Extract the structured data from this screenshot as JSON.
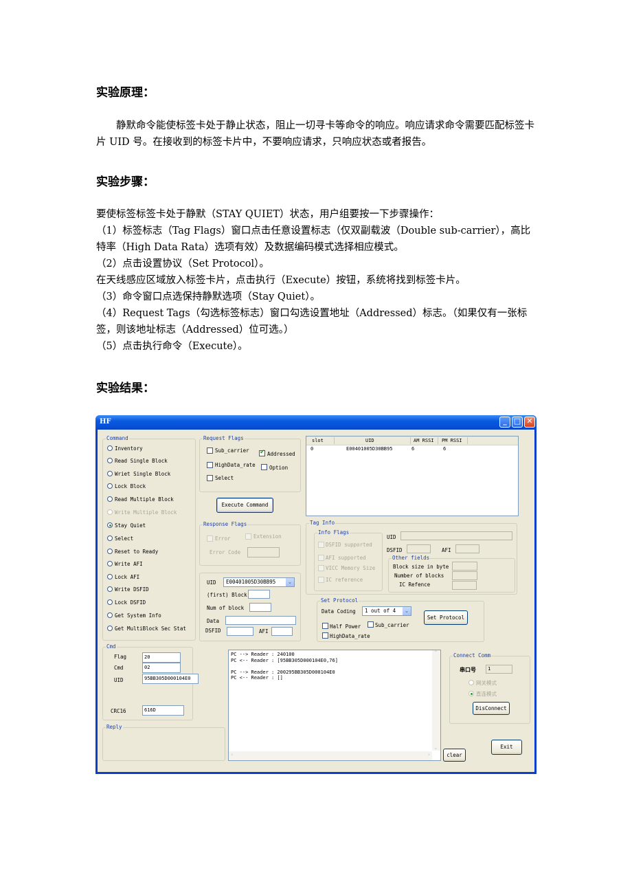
{
  "document": {
    "sections": [
      {
        "title": "实验原理：",
        "paragraphs": [
          "静默命令能使标签卡处于静止状态，阻止一切寻卡等命令的响应。响应请求命令需要匹配标签卡片 UID 号。在接收到的标签卡片中，不要响应请求，只响应状态或者报告。"
        ]
      },
      {
        "title": "实验步骤：",
        "paragraphs": [
          "要使标签标签卡处于静默（STAY QUIET）状态，用户组要按一下步骤操作：",
          "（1）标签标志（Tag Flags）窗口点击任意设置标志（仅双副载波（Double sub-carrier），高比特率（High Data Rata）选项有效）及数据编码模式选择相应模式。",
          "（2）点击设置协议（Set Protocol）。",
          "在天线感应区域放入标签卡片，点击执行（Execute）按钮，系统将找到标签卡片。",
          "（3）命令窗口点选保持静默选项（Stay Quiet）。",
          "（4）Request Tags（勾选标签标志）窗口勾选设置地址（Addressed）标志。（如果仅有一张标签，则该地址标志（Addressed）位可选。）",
          "（5）点击执行命令（Execute）。"
        ]
      },
      {
        "title": "实验结果：",
        "paragraphs": []
      }
    ]
  },
  "window": {
    "title": "HF",
    "controls": {
      "minimize": "_",
      "maximize": "□",
      "close": "✕"
    },
    "command": {
      "legend": "Command",
      "options": [
        {
          "label": "Inventory",
          "selected": false,
          "enabled": true
        },
        {
          "label": "Read Single Block",
          "selected": false,
          "enabled": true
        },
        {
          "label": "Wriet Single Block",
          "selected": false,
          "enabled": true
        },
        {
          "label": "Lock Block",
          "selected": false,
          "enabled": true
        },
        {
          "label": "Read Multiple Block",
          "selected": false,
          "enabled": true
        },
        {
          "label": "Write Multiple Block",
          "selected": false,
          "enabled": false
        },
        {
          "label": "Stay Quiet",
          "selected": true,
          "enabled": true
        },
        {
          "label": "Select",
          "selected": false,
          "enabled": true
        },
        {
          "label": "Reset to Ready",
          "selected": false,
          "enabled": true
        },
        {
          "label": "Write AFI",
          "selected": false,
          "enabled": true
        },
        {
          "label": "Lock AFI",
          "selected": false,
          "enabled": true
        },
        {
          "label": "Write DSFID",
          "selected": false,
          "enabled": true
        },
        {
          "label": "Lock DSFID",
          "selected": false,
          "enabled": true
        },
        {
          "label": "Get System Info",
          "selected": false,
          "enabled": true
        },
        {
          "label": "Get MultiBlock Sec Stat",
          "selected": false,
          "enabled": true
        }
      ]
    },
    "request_flags": {
      "legend": "Request Flags",
      "sub_carrier": {
        "label": "Sub_carrier",
        "checked": false
      },
      "addressed": {
        "label": "Addressed",
        "checked": true
      },
      "high_data_rate": {
        "label": "HighData_rate",
        "checked": false
      },
      "option": {
        "label": "Option",
        "checked": false
      },
      "select": {
        "label": "Select",
        "checked": false
      }
    },
    "execute_button": "Execute Command",
    "response_flags": {
      "legend": "Response Flags",
      "error": "Error",
      "extension": "Extension",
      "error_code_label": "Error Code",
      "error_code_value": ""
    },
    "params": {
      "uid_label": "UID",
      "uid_value": "E00401005D30BB95",
      "first_block_label": "(first) Block",
      "first_block_value": "",
      "num_block_label": "Num of block",
      "num_block_value": "",
      "data_label": "Data",
      "data_value": "",
      "dsfid_label": "DSFID",
      "dsfid_value": "",
      "afi_label": "AFI",
      "afi_value": ""
    },
    "inventory_table": {
      "columns": [
        "slot",
        "UID",
        "AM RSSI",
        "PM RSSI"
      ],
      "rows": [
        [
          "0",
          "E00401005D30BB95",
          "6",
          "6"
        ]
      ]
    },
    "tag_info": {
      "legend": "Tag Info",
      "info_flags_legend": "Info Flags",
      "info_flags": [
        "DSFID supported",
        "AFI supported",
        "VICC Memory Size",
        "IC reference"
      ],
      "uid_label": "UID",
      "uid_value": "",
      "dsfid_label": "DSFID",
      "dsfid_value": "",
      "afi_label": "AFI",
      "afi_value": "",
      "other_fields_legend": "Other fields",
      "block_size_label": "Block size in byte",
      "block_size_value": "",
      "num_blocks_label": "Number of blocks",
      "num_blocks_value": "",
      "ic_ref_label": "IC Refence",
      "ic_ref_value": ""
    },
    "set_protocol": {
      "legend": "Set Protocol",
      "data_coding_label": "Data Coding",
      "data_coding_value": "1 out of 4",
      "half_power": {
        "label": "Half Power",
        "checked": false
      },
      "sub_carrier": {
        "label": "Sub_carrier",
        "checked": false
      },
      "high_data_rate": {
        "label": "HighData_rate",
        "checked": false
      },
      "button": "Set Protocol"
    },
    "cmd": {
      "legend": "Cmd",
      "flag_label": "Flag",
      "flag_value": "20",
      "cmd_label": "Cmd",
      "cmd_value": "02",
      "uid_label": "UID",
      "uid_value": "95BB305D000104E0",
      "crc_label": "CRC16",
      "crc_value": "616D"
    },
    "reply": {
      "legend": "Reply"
    },
    "log": [
      "PC --> Reader : 240100",
      "PC <-- Reader : [95BB305D000104E0,76]",
      "",
      "PC --> Reader : 200295BB305D000104E0",
      "PC <-- Reader : []"
    ],
    "clear_button": "clear",
    "connect": {
      "legend": "Connect Comm",
      "port_label": "串口号",
      "port_value": "1",
      "gateway_mode": "网关模式",
      "direct_mode": "直连模式",
      "direct_selected": true,
      "disconnect_button": "DisConnect"
    },
    "exit_button": "Exit"
  }
}
